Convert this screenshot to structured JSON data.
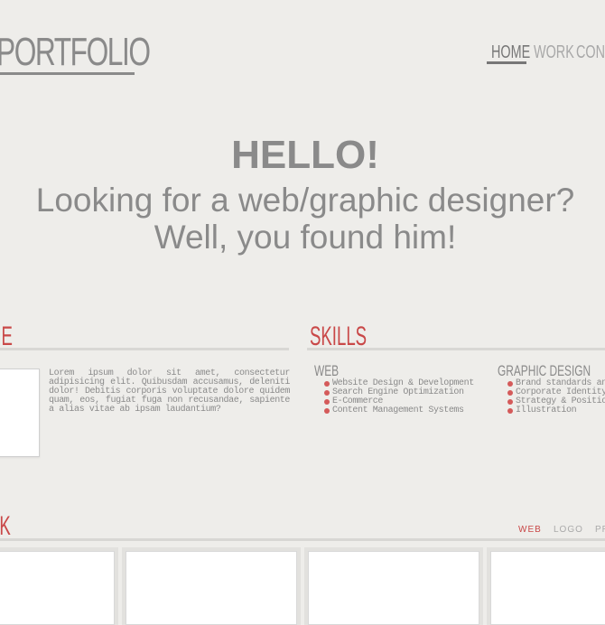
{
  "header": {
    "logo": "PORTFOLIO",
    "nav": [
      "HOME",
      "WORK",
      "CONTA"
    ]
  },
  "hero": {
    "title": "HELLO!",
    "line1": "Looking for a web/graphic designer?",
    "line2": "Well, you found him!"
  },
  "about": {
    "heading": "ME",
    "text": "Lorem ipsum dolor sit amet, consectetur adipisicing elit. Quibusdam accusamus, deleniti dolor! Debitis corporis voluptate dolore quidem quam, eos, fugiat fuga non recusandae, sapiente a alias vitae ab ipsam laudantium?"
  },
  "skills": {
    "heading": "SKILLS",
    "web": {
      "title": "WEB",
      "items": [
        "Website Design & Development",
        "Search Engine Optimization",
        "E-Commerce",
        "Content Management Systems"
      ]
    },
    "graphic": {
      "title": "GRAPHIC DESIGN",
      "items": [
        "Brand standards and",
        "Corporate Identity",
        "Strategy & Positioni",
        "Illustration"
      ]
    }
  },
  "work": {
    "heading": "RK",
    "filters": [
      "WEB",
      "LOGO",
      "PR"
    ]
  },
  "colors": {
    "accent": "#c94848",
    "text": "#8a8a8a",
    "background": "#eeedea"
  }
}
